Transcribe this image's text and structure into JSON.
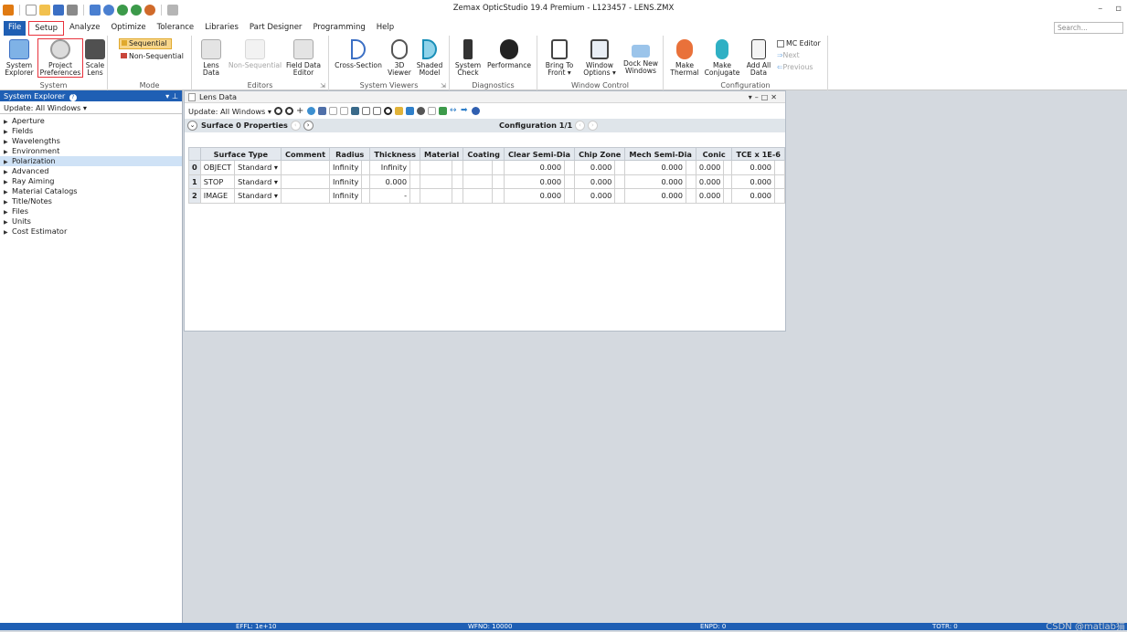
{
  "app": {
    "title": "Zemax OpticStudio 19.4   Premium - L123457 - LENS.ZMX",
    "search_placeholder": "Search..."
  },
  "menu": {
    "tabs": [
      "File",
      "Setup",
      "Analyze",
      "Optimize",
      "Tolerance",
      "Libraries",
      "Part Designer",
      "Programming",
      "Help"
    ],
    "active": "Setup"
  },
  "ribbon": {
    "groups": [
      {
        "label": "System",
        "buttons": [
          "System\nExplorer",
          "Project\nPreferences",
          "Scale\nLens"
        ]
      },
      {
        "label": "Mode",
        "buttons": [
          "Sequential",
          "Non-Sequential"
        ]
      },
      {
        "label": "Editors",
        "buttons": [
          "Lens\nData",
          "Non-Sequential",
          "Field Data\nEditor"
        ]
      },
      {
        "label": "System Viewers",
        "buttons": [
          "Cross-Section",
          "3D\nViewer",
          "Shaded\nModel"
        ]
      },
      {
        "label": "Diagnostics",
        "buttons": [
          "System\nCheck",
          "Performance"
        ]
      },
      {
        "label": "Window Control",
        "buttons": [
          "Bring To\nFront ▾",
          "Window\nOptions ▾",
          "Dock New\nWindows"
        ]
      },
      {
        "label": "Configuration",
        "buttons": [
          "Make\nThermal",
          "Make\nConjugate",
          "Add All\nData",
          "MC Editor",
          "Next",
          "Previous"
        ]
      }
    ]
  },
  "explorer": {
    "title": "System Explorer",
    "update": "Update: All Windows ▾",
    "items": [
      "Aperture",
      "Fields",
      "Wavelengths",
      "Environment",
      "Polarization",
      "Advanced",
      "Ray Aiming",
      "Material Catalogs",
      "Title/Notes",
      "Files",
      "Units",
      "Cost Estimator"
    ],
    "selected": "Polarization"
  },
  "lens_data": {
    "title": "Lens Data",
    "update": "Update: All Windows ▾",
    "surface_label": "Surface  0 Properties",
    "config_label": "Configuration 1/1",
    "columns": [
      "Surface Type",
      "Comment",
      "Radius",
      "Thickness",
      "Material",
      "Coating",
      "Clear Semi-Dia",
      "Chip Zone",
      "Mech Semi-Dia",
      "Conic",
      "TCE x 1E-6"
    ],
    "rows": [
      {
        "n": "0",
        "name": "OBJECT",
        "type": "Standard ▾",
        "comment": "",
        "radius": "Infinity",
        "thickness": "Infinity",
        "material": "",
        "coating": "",
        "clear": "0.000",
        "chip": "0.000",
        "mech": "0.000",
        "conic": "0.000",
        "tce": "0.000"
      },
      {
        "n": "1",
        "name": "STOP",
        "type": "Standard ▾",
        "comment": "",
        "radius": "Infinity",
        "thickness": "0.000",
        "material": "",
        "coating": "",
        "clear": "0.000",
        "chip": "0.000",
        "mech": "0.000",
        "conic": "0.000",
        "tce": "0.000"
      },
      {
        "n": "2",
        "name": "IMAGE",
        "type": "Standard ▾",
        "comment": "",
        "radius": "Infinity",
        "thickness": "-",
        "material": "",
        "coating": "",
        "clear": "0.000",
        "chip": "0.000",
        "mech": "0.000",
        "conic": "0.000",
        "tce": "0.000"
      }
    ]
  },
  "status": {
    "effl": "EFFL: 1e+10",
    "wfno": "WFNO: 10000",
    "enpd": "ENPD: 0",
    "totr": "TOTR: 0"
  },
  "watermark": "CSDN @matlab猫",
  "colors": {
    "accent": "#1f5fb4",
    "highlight": "#e8323c",
    "selection": "#cfe2f6"
  }
}
